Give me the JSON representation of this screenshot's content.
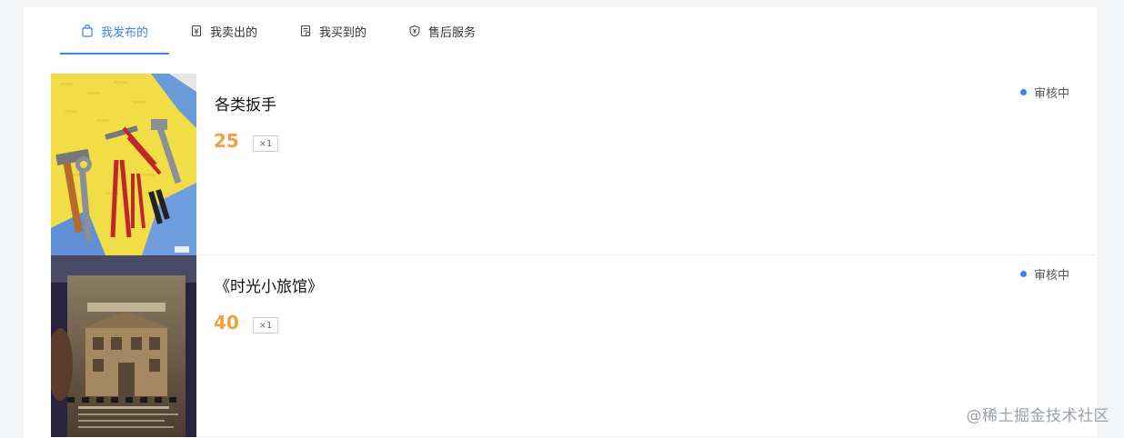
{
  "tabs": [
    {
      "label": "我发布的",
      "icon": "bag-icon",
      "active": true
    },
    {
      "label": "我卖出的",
      "icon": "sold-icon",
      "active": false
    },
    {
      "label": "我买到的",
      "icon": "receipt-icon",
      "active": false
    },
    {
      "label": "售后服务",
      "icon": "shield-icon",
      "active": false
    }
  ],
  "items": [
    {
      "title": "各类扳手",
      "price": "25",
      "qty": "×1",
      "status": "审核中",
      "image": "tools-photo"
    },
    {
      "title": "《时光小旅馆》",
      "price": "40",
      "qty": "×1",
      "status": "审核中",
      "image": "book-cover-photo"
    }
  ],
  "watermark": "@稀土掘金技术社区",
  "colors": {
    "accent": "#3b82f6",
    "price": "#f0a03c",
    "background": "#f4f5f7"
  }
}
